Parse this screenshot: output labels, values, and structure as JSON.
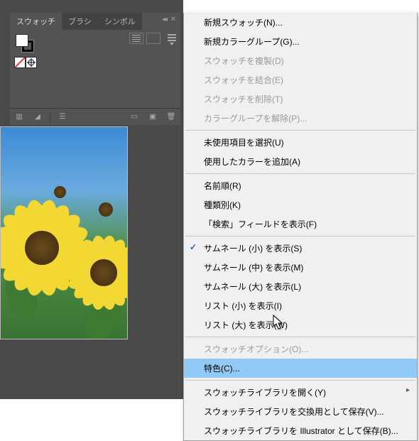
{
  "tabs": {
    "swatches": "スウォッチ",
    "brushes": "ブラシ",
    "symbols": "シンボル"
  },
  "menu": {
    "new_swatch": "新規スウォッチ(N)...",
    "new_color_group": "新規カラーグループ(G)...",
    "duplicate_swatch": "スウォッチを複製(D)",
    "merge_swatch": "スウォッチを結合(E)",
    "delete_swatch": "スウォッチを削除(T)",
    "ungroup_color_group": "カラーグループを解除(P)...",
    "select_unused": "未使用項目を選択(U)",
    "add_used_colors": "使用したカラーを追加(A)",
    "sort_name": "名前順(R)",
    "sort_kind": "種類別(K)",
    "show_find": "「検索」フィールドを表示(F)",
    "thumb_small": "サムネール (小) を表示(S)",
    "thumb_medium": "サムネール (中) を表示(M)",
    "thumb_large": "サムネール (大) を表示(L)",
    "list_small": "リスト (小) を表示(I)",
    "list_large": "リスト (大) を表示(W)",
    "swatch_options": "スウォッチオプション(O)...",
    "spot_color": "特色(C)...",
    "open_library": "スウォッチライブラリを開く(Y)",
    "save_exchange": "スウォッチライブラリを交換用として保存(V)...",
    "save_ai": "スウォッチライブラリを Illustrator として保存(B)..."
  }
}
